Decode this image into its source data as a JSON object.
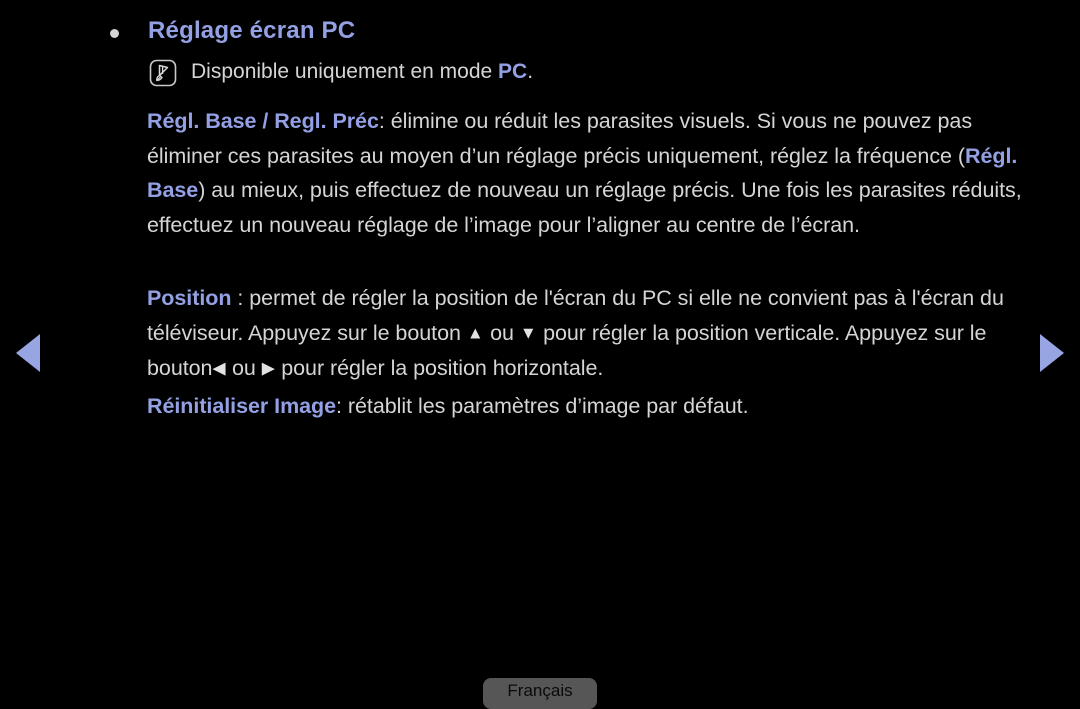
{
  "page": {
    "background_color": "#000000",
    "text_color": "#d5d5d5",
    "accent_color": "#94a0e4"
  },
  "heading": {
    "bullet": "•",
    "title": "Réglage écran PC"
  },
  "note": {
    "icon": "note-pen-icon",
    "text_before": "Disponible uniquement en mode ",
    "highlight": "PC",
    "text_after": "."
  },
  "sections": [
    {
      "id": "regl-base-prec",
      "term": "Régl. Base / Regl. Préc",
      "separator": ": ",
      "body_part1": "élimine ou réduit les parasites visuels. Si vous ne pouvez pas éliminer ces parasites au moyen d’un réglage précis uniquement, réglez la fréquence (",
      "inline_term": "Régl. Base",
      "body_part2": ") au mieux, puis effectuez de nouveau un réglage précis. Une fois les parasites réduits, effectuez un nouveau réglage de l’image pour l’aligner au centre de l’écran."
    },
    {
      "id": "position",
      "term": "Position",
      "separator": " : ",
      "body_part1": "permet de régler la position de l'écran du PC si elle ne convient pas à l'écran du téléviseur. Appuyez sur le bouton ",
      "glyph_up": "▲",
      "mid_text1": " ou ",
      "glyph_down": "▼",
      "mid_text2": " pour régler la position verticale. Appuyez sur le bouton",
      "glyph_left": "◀",
      "mid_text3": " ou ",
      "glyph_right": "▶",
      "body_part2": " pour régler la position horizontale."
    },
    {
      "id": "reinitialiser-image",
      "term": "Réinitialiser Image",
      "separator": ": ",
      "body_part1": "rétablit les paramètres d’image par défaut."
    }
  ],
  "navigation": {
    "prev_label": "◀",
    "prev_name": "previous-page-arrow",
    "next_label": "▶",
    "next_name": "next-page-arrow"
  },
  "footer": {
    "language": "Français"
  }
}
